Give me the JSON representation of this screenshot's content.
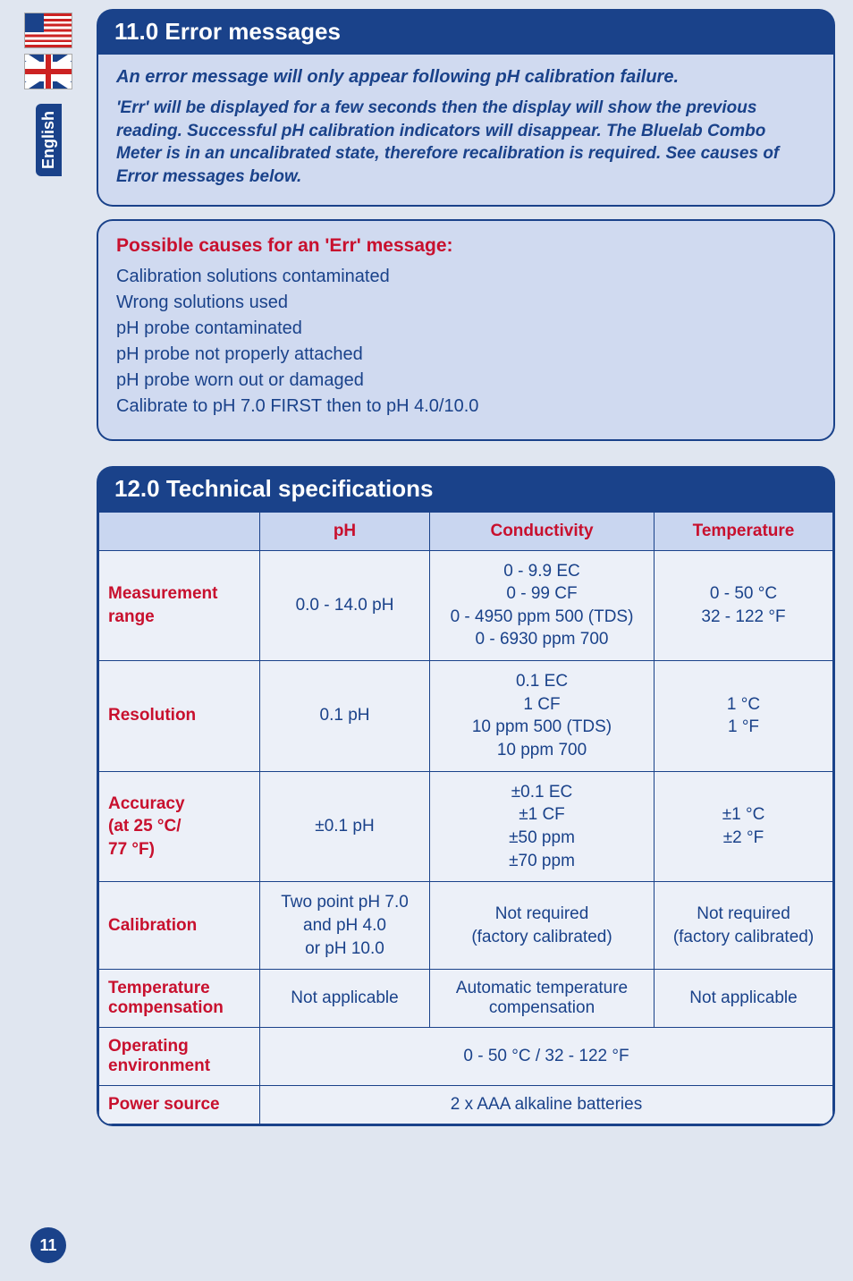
{
  "language_tab": "English",
  "page_number": "11",
  "section_11": {
    "heading": "11.0  Error messages",
    "intro_title": "An error message will only appear following pH calibration failure.",
    "intro_body": "'Err' will be displayed for a few seconds then the display will show the previous reading. Successful pH calibration indicators will disappear. The Bluelab Combo Meter is in an uncalibrated state, therefore recalibration is required. See causes of Error messages below.",
    "causes_title": "Possible causes for an 'Err' message:",
    "causes": [
      "Calibration solutions contaminated",
      "Wrong solutions used",
      "pH probe contaminated",
      "pH probe not properly attached",
      "pH probe worn out or damaged",
      "Calibrate to pH 7.0 FIRST then to pH 4.0/10.0"
    ]
  },
  "section_12": {
    "heading": "12.0  Technical specifications",
    "columns": [
      "",
      "pH",
      "Conductivity",
      "Temperature"
    ],
    "rows": {
      "measurement_range": {
        "label": "Measurement range",
        "ph": "0.0 - 14.0 pH",
        "cond": "0 - 9.9 EC\n0 - 99 CF\n0 - 4950 ppm 500 (TDS)\n0 - 6930 ppm 700",
        "temp": "0 - 50 °C\n32 - 122 °F"
      },
      "resolution": {
        "label": "Resolution",
        "ph": "0.1 pH",
        "cond": "0.1 EC\n1 CF\n10 ppm 500 (TDS)\n10 ppm 700",
        "temp": "1 °C\n1 °F"
      },
      "accuracy": {
        "label": "Accuracy\n(at 25 °C/\n77 °F)",
        "ph": "±0.1 pH",
        "cond": "±0.1 EC\n±1 CF\n±50 ppm\n±70 ppm",
        "temp": "±1 °C\n±2 °F"
      },
      "calibration": {
        "label": "Calibration",
        "ph": "Two point pH 7.0\nand pH 4.0\nor pH 10.0",
        "cond": "Not required\n(factory calibrated)",
        "temp": "Not required\n(factory calibrated)"
      },
      "temp_comp": {
        "label": "Temperature compensation",
        "ph": "Not applicable",
        "cond": "Automatic temperature compensation",
        "temp": "Not applicable"
      },
      "operating_env": {
        "label": "Operating environment",
        "value": "0 - 50 °C / 32 - 122 °F"
      },
      "power_source": {
        "label": "Power source",
        "value": "2 x AAA alkaline batteries"
      }
    }
  }
}
